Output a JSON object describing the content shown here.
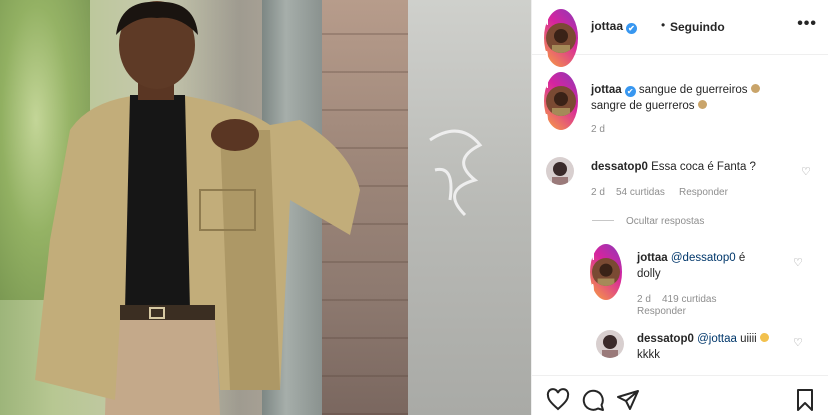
{
  "post": {
    "username": "jottaa",
    "separator": "•",
    "follow_label": "Seguindo",
    "more_label": "•••",
    "verified_icon": "✔"
  },
  "caption": {
    "username": "jottaa",
    "line1": "sangue de guerreiros",
    "line2": "sangre de guerreros",
    "time": "2 d"
  },
  "comments": [
    {
      "username": "dessatop0",
      "text": "Essa coca é Fanta ?",
      "time": "2 d",
      "likes": "54 curtidas",
      "reply_label": "Responder"
    },
    {
      "username": "jottaa",
      "mention": "@dessatop0",
      "text_line1": "é",
      "text_line2": "dolly",
      "time": "2 d",
      "likes": "419 curtidas",
      "reply_label": "Responder"
    },
    {
      "username": "dessatop0",
      "mention": "@jottaa",
      "text_line1": "uiiii",
      "text_line2": "kkkk"
    }
  ],
  "hide_replies_label": "Ocultar respostas",
  "icons": {
    "like": "heart-icon",
    "comment": "comment-icon",
    "share": "share-icon",
    "save": "bookmark-icon"
  },
  "colors": {
    "verified": "#3897f0",
    "muted": "#8e8e8e",
    "text": "#262626"
  }
}
